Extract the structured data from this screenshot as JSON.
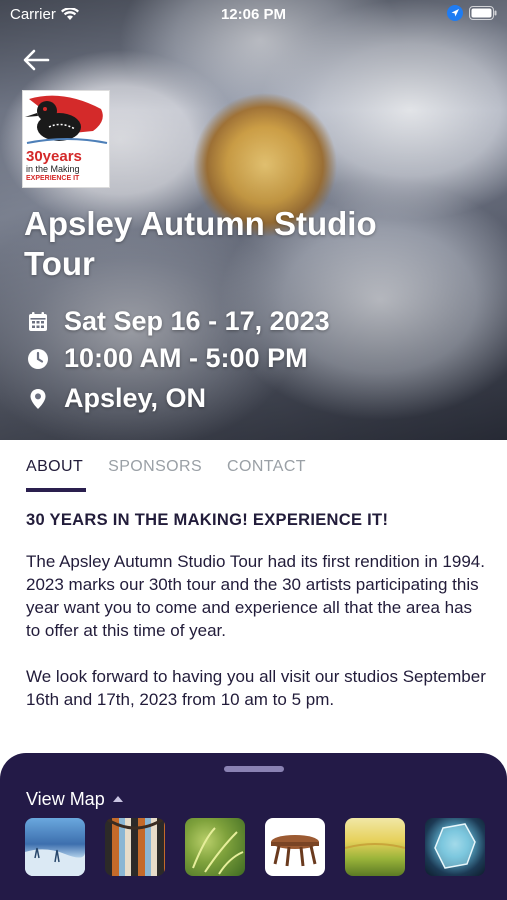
{
  "status_bar": {
    "carrier": "Carrier",
    "time": "12:06 PM"
  },
  "logo": {
    "line1": "30years",
    "line2": "in the Making",
    "line3": "EXPERIENCE IT"
  },
  "event": {
    "title": "Apsley Autumn Studio Tour",
    "date": "Sat Sep 16 - 17, 2023",
    "time": "10:00 AM - 5:00 PM",
    "location": "Apsley, ON"
  },
  "tabs": [
    {
      "label": "ABOUT",
      "active": true
    },
    {
      "label": "SPONSORS",
      "active": false
    },
    {
      "label": "CONTACT",
      "active": false
    }
  ],
  "about": {
    "headline": "30 YEARS IN THE MAKING!  EXPERIENCE IT!",
    "paragraph1": "The Apsley Autumn Studio Tour had its first rendition in 1994.  2023 marks our 30th tour and the 30 artists participating this year want you to come and experience all that the area has to offer at this time of year.",
    "paragraph2": "We look forward to having you all visit our studios September 16th and 17th, 2023 from 10 am to 5 pm."
  },
  "sheet": {
    "view_map_label": "View Map"
  },
  "colors": {
    "sheet_bg": "#231a47",
    "tab_active": "#221c3a",
    "tab_inactive": "#9aa0a6",
    "logo_red": "#d42a2a"
  }
}
